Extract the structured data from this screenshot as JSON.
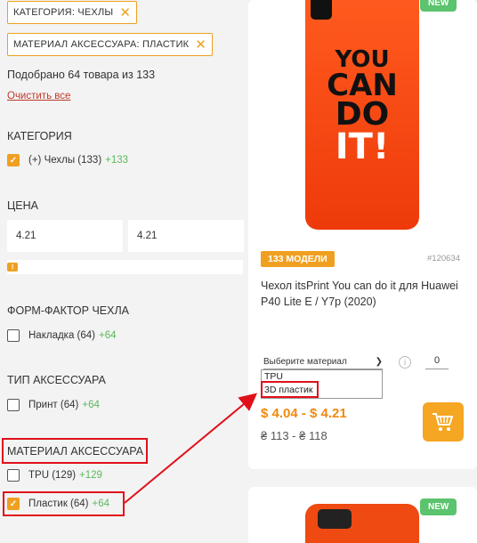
{
  "filters": {
    "chips": [
      {
        "label": "КАТЕГОРИЯ: ЧЕХЛЫ"
      },
      {
        "label": "МАТЕРИАЛ АКСЕССУАРА: ПЛАСТИК"
      }
    ],
    "found_text": "Подобрано 64 товара из 133",
    "clear_label": "Очистить все",
    "category": {
      "title": "КАТЕГОРИЯ",
      "options": [
        {
          "label": "(+) Чехлы (133)",
          "count": "+133",
          "checked": true
        }
      ]
    },
    "price": {
      "title": "ЦЕНА",
      "min": "4.21",
      "max": "4.21"
    },
    "form_factor": {
      "title": "ФОРМ-ФАКТОР ЧЕХЛА",
      "options": [
        {
          "label": "Накладка (64)",
          "count": "+64",
          "checked": false
        }
      ]
    },
    "accessory_type": {
      "title": "ТИП АКСЕССУАРА",
      "options": [
        {
          "label": "Принт (64)",
          "count": "+64",
          "checked": false
        }
      ]
    },
    "material": {
      "title": "МАТЕРИАЛ АКСЕССУАРА",
      "options": [
        {
          "label": "TPU (129)",
          "count": "+129",
          "checked": false
        },
        {
          "label": "Пластик (64)",
          "count": "+64",
          "checked": true
        }
      ]
    }
  },
  "product": {
    "badge_new": "NEW",
    "image_text": [
      "YOU",
      "CAN",
      "DO",
      "IT!"
    ],
    "models_badge": "133 МОДЕЛИ",
    "sku": "#120634",
    "name": "Чехол itsPrint You can do it для Huawei P40 Lite E / Y7p (2020)",
    "material_select": {
      "placeholder": "Выберите материал",
      "options": [
        "TPU",
        "3D пластик"
      ]
    },
    "qty": "0",
    "price_usd": "$ 4.04 - $ 4.21",
    "price_uah": "₴ 113 - ₴ 118"
  },
  "product2": {
    "badge_new": "NEW"
  },
  "colors": {
    "accent": "#f0a020",
    "annotation_red": "#e0101a",
    "plus_green": "#5cb85c",
    "new_green": "#5cc36e"
  }
}
